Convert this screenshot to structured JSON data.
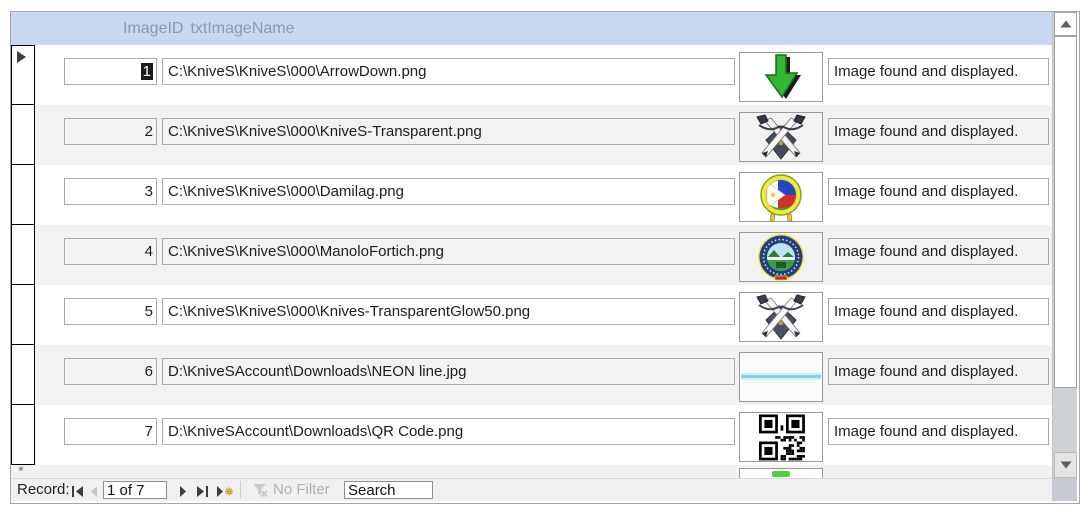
{
  "header": {
    "image_id_label": "ImageID",
    "image_name_label": "txtImageName"
  },
  "records": [
    {
      "id": "1",
      "path": "C:\\KniveS\\KniveS\\000\\ArrowDown.png",
      "status": "Image found and displayed.",
      "image": "arrow-down",
      "selected": true
    },
    {
      "id": "2",
      "path": "C:\\KniveS\\KniveS\\000\\KniveS-Transparent.png",
      "status": "Image found and displayed.",
      "image": "knives-logo"
    },
    {
      "id": "3",
      "path": "C:\\KniveS\\KniveS\\000\\Damilag.png",
      "status": "Image found and displayed.",
      "image": "damilag-seal"
    },
    {
      "id": "4",
      "path": "C:\\KniveS\\KniveS\\000\\ManoloFortich.png",
      "status": "Image found and displayed.",
      "image": "manolo-fortich-seal"
    },
    {
      "id": "5",
      "path": "C:\\KniveS\\KniveS\\000\\Knives-TransparentGlow50.png",
      "status": "Image found and displayed.",
      "image": "knives-glow"
    },
    {
      "id": "6",
      "path": "D:\\KniveSAccount\\Downloads\\NEON line.jpg",
      "status": "Image found and displayed.",
      "image": "neon-line"
    },
    {
      "id": "7",
      "path": "D:\\KniveSAccount\\Downloads\\QR Code.png",
      "status": "Image found and displayed.",
      "image": "qr-code"
    }
  ],
  "new_record": {
    "marker": "*"
  },
  "nav": {
    "record_label": "Record:",
    "position_value": "1 of 7",
    "no_filter_label": "No Filter",
    "search_value": "Search"
  },
  "colors": {
    "header_bg": "#c9d8f0",
    "header_text": "#8d99a9",
    "row_alt": "#f2f2f2",
    "selection_bg": "#1c1c1c",
    "arrow_green": "#35b535",
    "neon_line": "#7fd4ea",
    "new_record_star": "#d2a240"
  }
}
